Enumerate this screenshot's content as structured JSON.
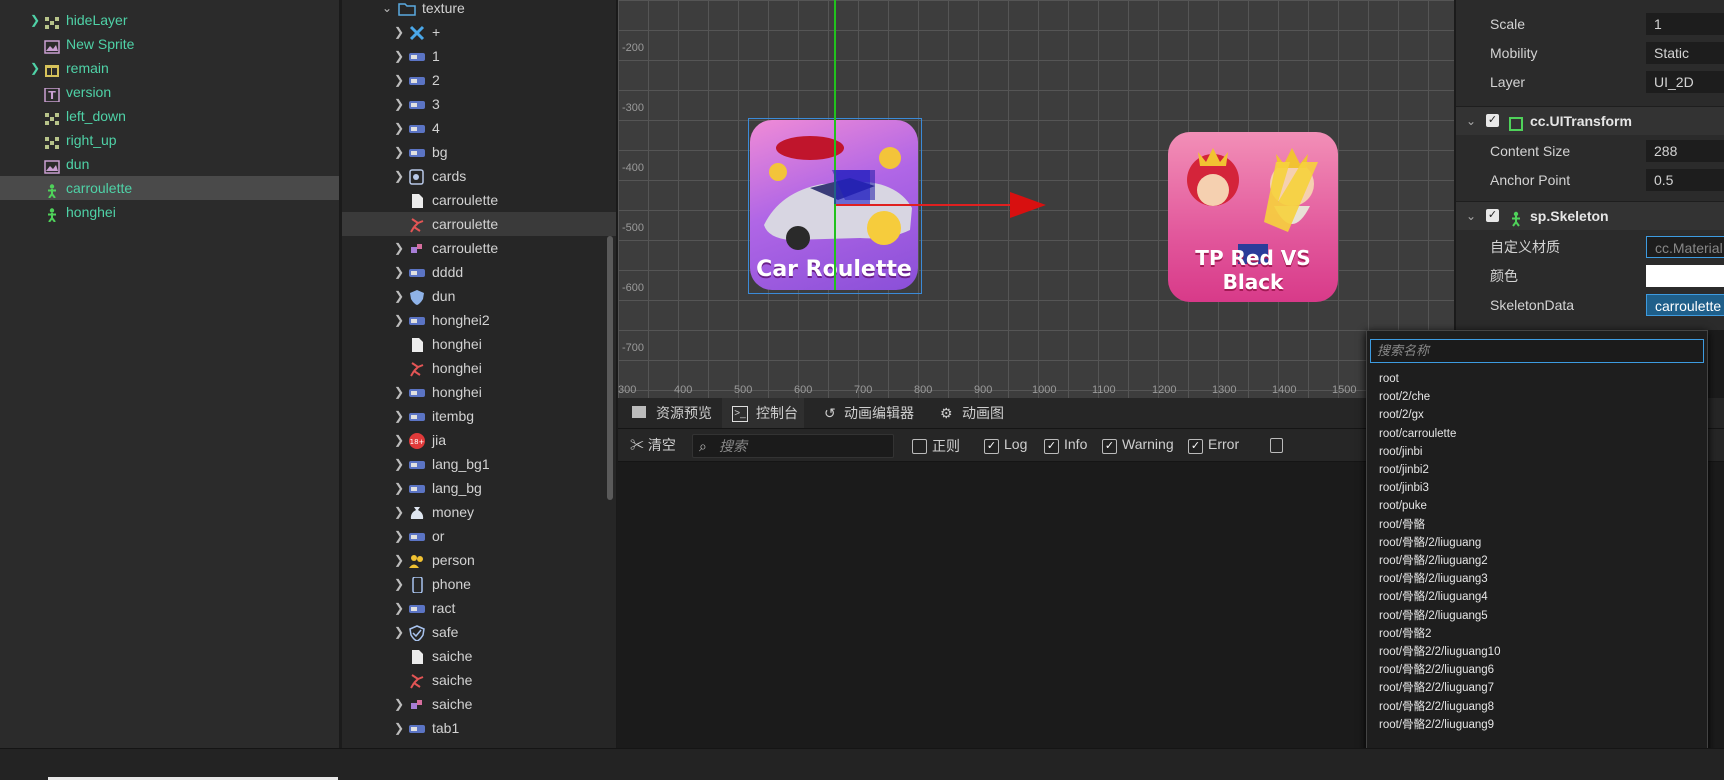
{
  "hierarchy": {
    "items": [
      {
        "label": "hideLayer",
        "icon": "layer-grid-icon",
        "expandable": true
      },
      {
        "label": "New Sprite",
        "icon": "sprite-icon",
        "expandable": false
      },
      {
        "label": "remain",
        "icon": "layout-icon",
        "expandable": true
      },
      {
        "label": "version",
        "icon": "text-icon",
        "expandable": false
      },
      {
        "label": "left_down",
        "icon": "layer-grid-icon",
        "expandable": false
      },
      {
        "label": "right_up",
        "icon": "layer-grid-icon",
        "expandable": false
      },
      {
        "label": "dun",
        "icon": "sprite-icon",
        "expandable": false
      },
      {
        "label": "carroulette",
        "icon": "skeleton-icon",
        "expandable": false,
        "selected": true
      },
      {
        "label": "honghei",
        "icon": "skeleton-icon",
        "expandable": false
      }
    ]
  },
  "assets": {
    "root_label": "texture",
    "items": [
      {
        "label": "+",
        "icon": "x-icon"
      },
      {
        "label": "1",
        "icon": "image-icon"
      },
      {
        "label": "2",
        "icon": "image-icon"
      },
      {
        "label": "3",
        "icon": "image-icon"
      },
      {
        "label": "4",
        "icon": "image-icon"
      },
      {
        "label": "bg",
        "icon": "image-icon"
      },
      {
        "label": "cards",
        "icon": "cards-icon"
      },
      {
        "label": "carroulette",
        "icon": "file-icon"
      },
      {
        "label": "carroulette",
        "icon": "spine-icon",
        "selected": true
      },
      {
        "label": "carroulette",
        "icon": "atlas-icon"
      },
      {
        "label": "dddd",
        "icon": "image-icon"
      },
      {
        "label": "dun",
        "icon": "shield-icon"
      },
      {
        "label": "honghei2",
        "icon": "image-icon"
      },
      {
        "label": "honghei",
        "icon": "file-icon"
      },
      {
        "label": "honghei",
        "icon": "spine-icon"
      },
      {
        "label": "honghei",
        "icon": "image-icon"
      },
      {
        "label": "itembg",
        "icon": "image-icon"
      },
      {
        "label": "jia",
        "icon": "age-badge-icon"
      },
      {
        "label": "lang_bg1",
        "icon": "image-icon"
      },
      {
        "label": "lang_bg",
        "icon": "image-icon"
      },
      {
        "label": "money",
        "icon": "money-bag-icon"
      },
      {
        "label": "or",
        "icon": "image-icon"
      },
      {
        "label": "person",
        "icon": "person-icon"
      },
      {
        "label": "phone",
        "icon": "phone-icon"
      },
      {
        "label": "ract",
        "icon": "image-icon"
      },
      {
        "label": "safe",
        "icon": "shield-check-icon"
      },
      {
        "label": "saiche",
        "icon": "file-icon"
      },
      {
        "label": "saiche",
        "icon": "spine-icon"
      },
      {
        "label": "saiche",
        "icon": "atlas-icon"
      },
      {
        "label": "tab1",
        "icon": "image-icon"
      }
    ]
  },
  "scene": {
    "y_ticks": [
      "-200",
      "-300",
      "-400",
      "-500",
      "-600",
      "-700"
    ],
    "x_ticks": [
      "300",
      "400",
      "500",
      "600",
      "700",
      "800",
      "900",
      "1000",
      "1100",
      "1200",
      "1300",
      "1400",
      "1500"
    ],
    "cards": [
      {
        "caption": "Car Roulette"
      },
      {
        "caption": "TP Red VS Black"
      }
    ]
  },
  "console": {
    "tabs": [
      "资源预览",
      "控制台",
      "动画编辑器",
      "动画图"
    ],
    "active_tab": "控制台",
    "clear_label": "清空",
    "search_placeholder": "搜索",
    "filters": [
      {
        "label": "正则",
        "checked": false
      },
      {
        "label": "Log",
        "checked": true
      },
      {
        "label": "Info",
        "checked": true
      },
      {
        "label": "Warning",
        "checked": true
      },
      {
        "label": "Error",
        "checked": true
      }
    ]
  },
  "inspector": {
    "props_top": [
      {
        "label": "Scale",
        "value": "1"
      },
      {
        "label": "Mobility",
        "value": "Static"
      },
      {
        "label": "Layer",
        "value": "UI_2D"
      }
    ],
    "ui_transform": {
      "title": "cc.UITransform",
      "props": [
        {
          "label": "Content Size",
          "value": "288"
        },
        {
          "label": "Anchor Point",
          "value": "0.5"
        }
      ]
    },
    "skeleton": {
      "title": "sp.Skeleton",
      "props": [
        {
          "label": "自定义材质",
          "value": "cc.Material"
        },
        {
          "label": "颜色",
          "value": ""
        },
        {
          "label": "SkeletonData",
          "value": "carroulette"
        }
      ]
    }
  },
  "dropdown": {
    "search_placeholder": "搜索名称",
    "items": [
      "root",
      "root/2/che",
      "root/2/gx",
      "root/carroulette",
      "root/jinbi",
      "root/jinbi2",
      "root/jinbi3",
      "root/puke",
      "root/骨骼",
      "root/骨骼/2/liuguang",
      "root/骨骼/2/liuguang2",
      "root/骨骼/2/liuguang3",
      "root/骨骼/2/liuguang4",
      "root/骨骼/2/liuguang5",
      "root/骨骼2",
      "root/骨骼2/2/liuguang10",
      "root/骨骼2/2/liuguang6",
      "root/骨骼2/2/liuguang7",
      "root/骨骼2/2/liuguang8",
      "root/骨骼2/2/liuguang9"
    ]
  },
  "colors": {
    "node_green": "#4fd2a7",
    "accent_blue": "#3d9be0",
    "axis_red": "#e02020",
    "axis_green": "#21c21d"
  }
}
